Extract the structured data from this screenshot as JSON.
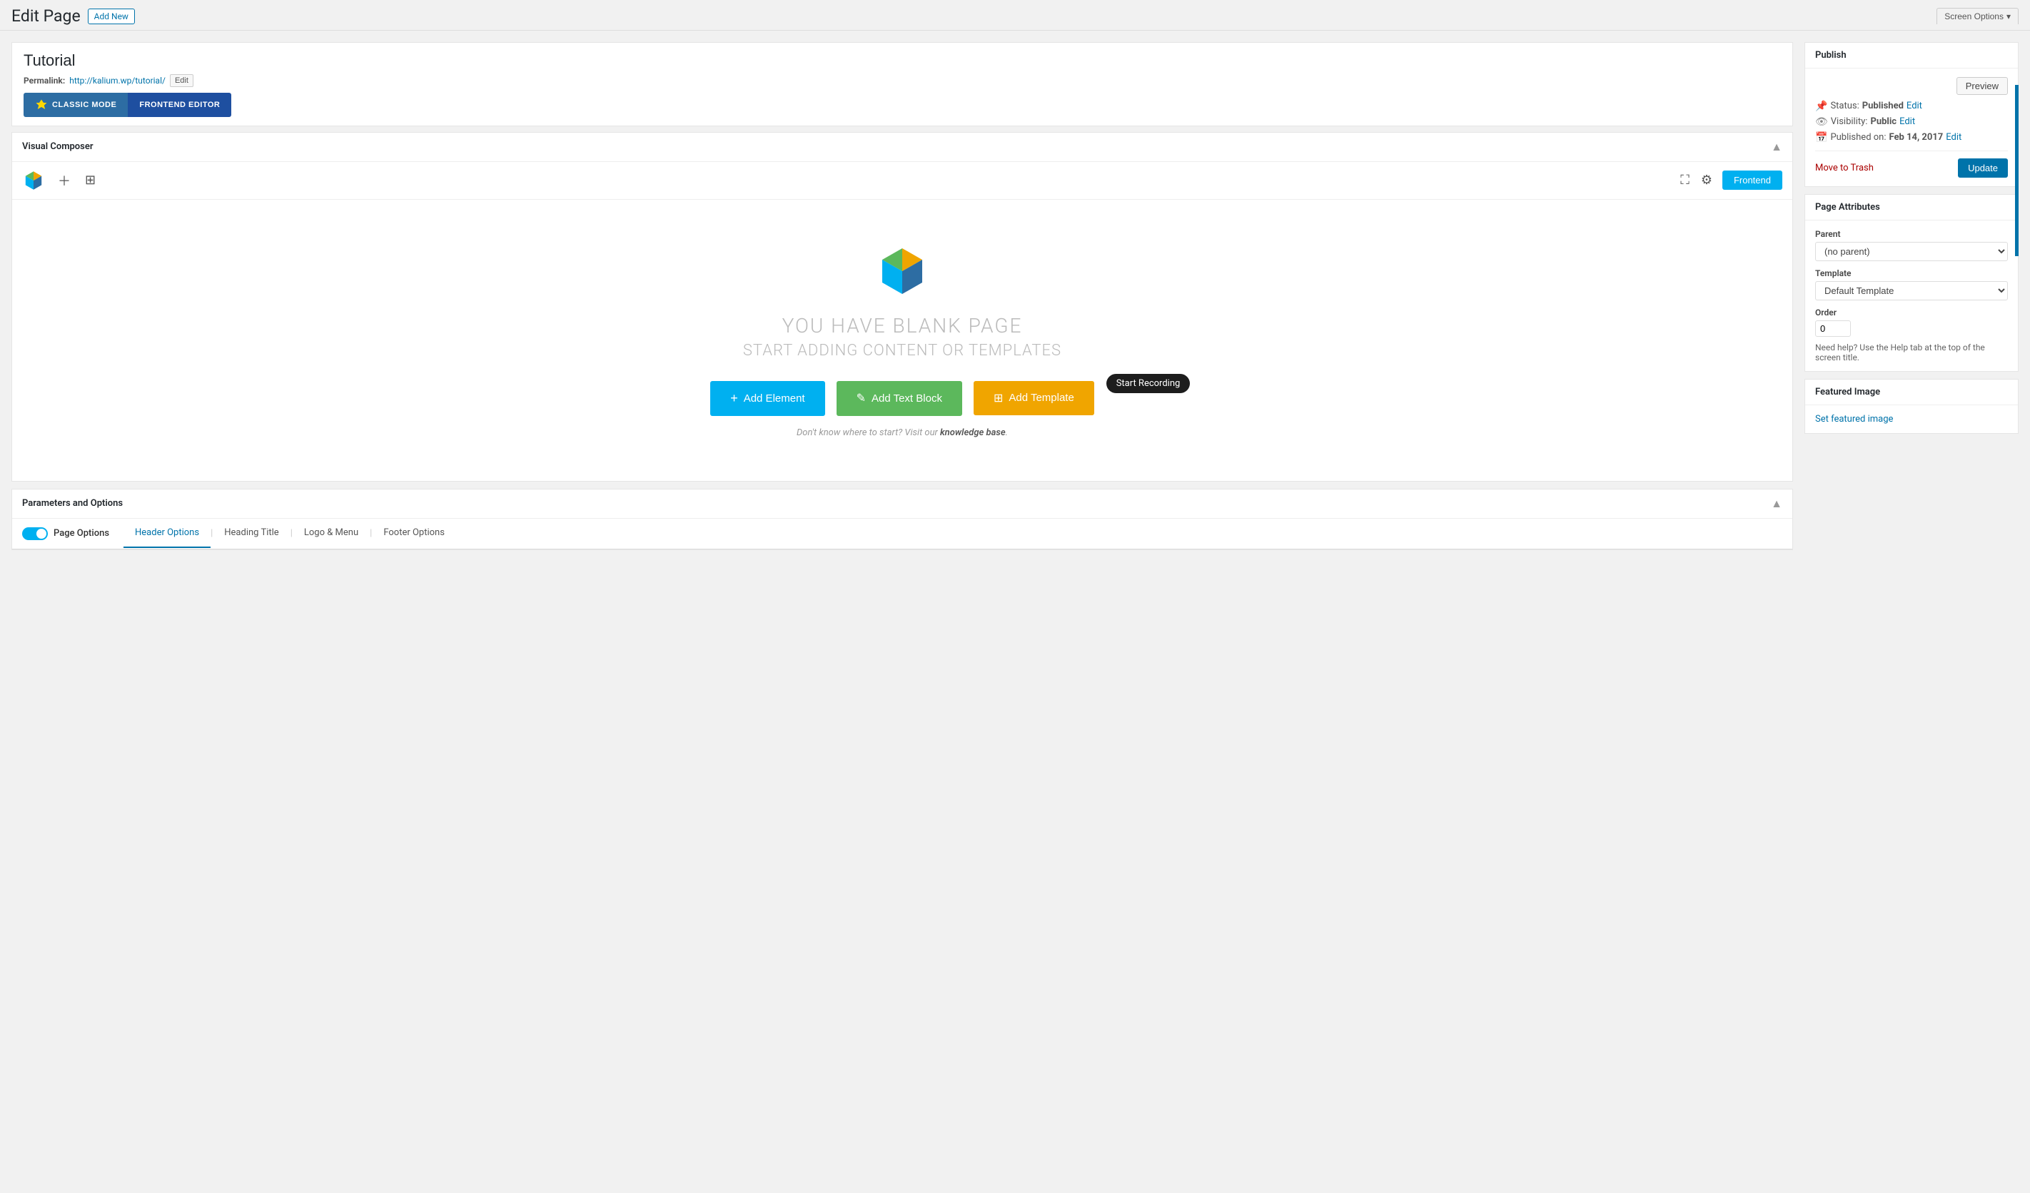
{
  "topBar": {
    "pageTitle": "Edit Page",
    "addNewLabel": "Add New",
    "screenOptionsLabel": "Screen Options"
  },
  "postTitle": "Tutorial",
  "permalink": {
    "label": "Permalink:",
    "url": "http://kalium.wp/tutorial/",
    "editLabel": "Edit"
  },
  "modes": {
    "classicLabel": "CLASSIC MODE",
    "frontendLabel": "FRONTEND EDITOR"
  },
  "visualComposer": {
    "panelTitle": "Visual Composer",
    "frontendBtnLabel": "Frontend",
    "emptyTitle": "YOU HAVE BLANK PAGE",
    "emptySubtitle": "START ADDING CONTENT OR TEMPLATES",
    "addElementLabel": "Add Element",
    "addTextBlockLabel": "Add Text Block",
    "addTemplateLabel": "Add Template",
    "helpTextBefore": "Don't know where to start? Visit our ",
    "helpLinkLabel": "knowledge base",
    "helpTextAfter": ".",
    "tooltipLabel": "Start Recording"
  },
  "parametersPanel": {
    "title": "Parameters and Options",
    "toggleLabel": "Page Options",
    "tabs": [
      {
        "label": "Header Options",
        "active": true
      },
      {
        "label": "Heading Title",
        "active": false
      },
      {
        "label": "Logo & Menu",
        "active": false
      },
      {
        "label": "Footer Options",
        "active": false
      }
    ]
  },
  "publishPanel": {
    "title": "Publish",
    "previewLabel": "Preview",
    "statusLabel": "Status:",
    "statusValue": "Published",
    "statusEditLabel": "Edit",
    "visibilityLabel": "Visibility:",
    "visibilityValue": "Public",
    "visibilityEditLabel": "Edit",
    "publishedLabel": "Published on:",
    "publishedDate": "Feb 14, 2017",
    "publishedEditLabel": "Edit",
    "moveToTrashLabel": "Move to Trash"
  },
  "pageAttributes": {
    "title": "Page Attributes",
    "parentLabel": "Parent",
    "parentDefault": "(no parent)",
    "templateLabel": "Template",
    "templateDefault": "Default Template",
    "orderLabel": "Order",
    "orderValue": "0",
    "helpText": "Need help? Use the Help tab at the top of the screen title."
  },
  "featuredImage": {
    "title": "Featured Image",
    "setLabel": "Set featured image"
  },
  "colors": {
    "blue": "#00b0f0",
    "green": "#5cb85c",
    "orange": "#f0a500",
    "wpBlue": "#0073aa",
    "darkBlue": "#2d6da3"
  }
}
